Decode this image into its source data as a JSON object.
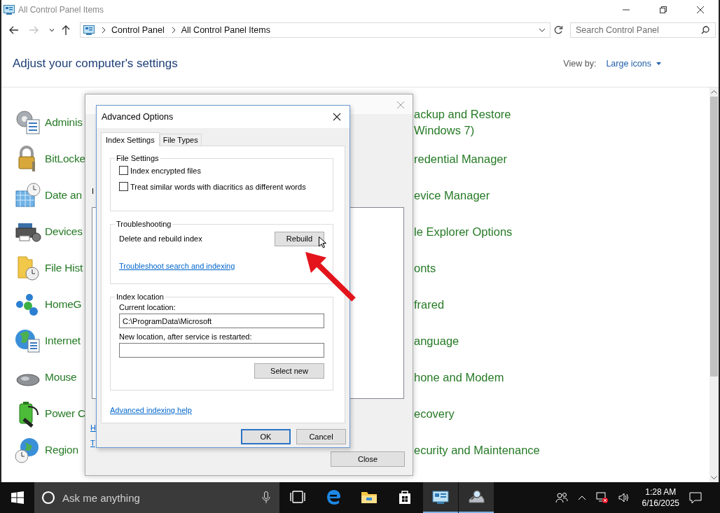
{
  "window": {
    "title": "All Control Panel Items"
  },
  "nav_buttons": [
    {
      "kind": "back",
      "disabled": false
    },
    {
      "kind": "forward",
      "disabled": true
    },
    {
      "kind": "recent",
      "disabled": false
    },
    {
      "kind": "up",
      "disabled": false
    }
  ],
  "address": {
    "crumbs": [
      "Control Panel",
      "All Control Panel Items"
    ]
  },
  "search": {
    "placeholder": "Search Control Panel"
  },
  "header": {
    "title": "Adjust your computer's settings",
    "view_by_label": "View by:",
    "view_by_value": "Large icons"
  },
  "items_left": [
    {
      "label": "Adminis",
      "kind": "admin"
    },
    {
      "label": "BitLocke",
      "kind": "bitlocker"
    },
    {
      "label": "Date an",
      "kind": "datetime"
    },
    {
      "label": "Devices",
      "kind": "devices"
    },
    {
      "label": "File Hist",
      "kind": "filehistory"
    },
    {
      "label": "HomeG",
      "kind": "homegroup"
    },
    {
      "label": "Internet",
      "kind": "internet"
    },
    {
      "label": "Mouse",
      "kind": "mouse"
    },
    {
      "label": "Power C",
      "kind": "power"
    },
    {
      "label": "Region",
      "kind": "region"
    }
  ],
  "items_right": [
    {
      "lines": [
        "ackup and Restore",
        "Windows 7)"
      ]
    },
    {
      "lines": [
        "redential Manager"
      ]
    },
    {
      "lines": [
        "evice Manager"
      ]
    },
    {
      "lines": [
        "le Explorer Options"
      ]
    },
    {
      "lines": [
        "onts"
      ]
    },
    {
      "lines": [
        "frared"
      ]
    },
    {
      "lines": [
        "anguage"
      ]
    },
    {
      "lines": [
        "hone and Modem"
      ]
    },
    {
      "lines": [
        "ecovery"
      ]
    },
    {
      "lines": [
        "ecurity and Maintenance"
      ]
    }
  ],
  "indexing_dialog": {
    "partial_label": "I",
    "links": [
      "H",
      "T"
    ],
    "close_button": "Close"
  },
  "advanced": {
    "title": "Advanced Options",
    "tabs": [
      {
        "label": "Index Settings",
        "selected": true
      },
      {
        "label": "File Types",
        "selected": false
      }
    ],
    "file_settings": {
      "legend": "File Settings",
      "options": [
        {
          "label": "Index encrypted files",
          "checked": false
        },
        {
          "label": "Treat similar words with diacritics as different words",
          "checked": false
        }
      ]
    },
    "troubleshooting": {
      "legend": "Troubleshooting",
      "rebuild_label": "Delete and rebuild index",
      "rebuild_button": "Rebuild",
      "link": "Troubleshoot search and indexing"
    },
    "location": {
      "legend": "Index location",
      "current_label": "Current location:",
      "current_value": "C:\\ProgramData\\Microsoft",
      "new_label": "New location, after service is restarted:",
      "select_button": "Select new"
    },
    "help_link": "Advanced indexing help",
    "buttons": [
      {
        "label": "OK",
        "default": true
      },
      {
        "label": "Cancel",
        "default": false
      }
    ]
  },
  "taskbar": {
    "search_placeholder": "Ask me anything",
    "apps": [
      {
        "kind": "taskview",
        "active": false
      },
      {
        "kind": "browser",
        "active": false
      },
      {
        "kind": "folder",
        "active": false
      },
      {
        "kind": "store",
        "active": false
      },
      {
        "kind": "controlpanel",
        "active": true
      },
      {
        "kind": "indexing",
        "active": true
      }
    ],
    "time": "1:28 AM",
    "date": "6/16/2025"
  }
}
